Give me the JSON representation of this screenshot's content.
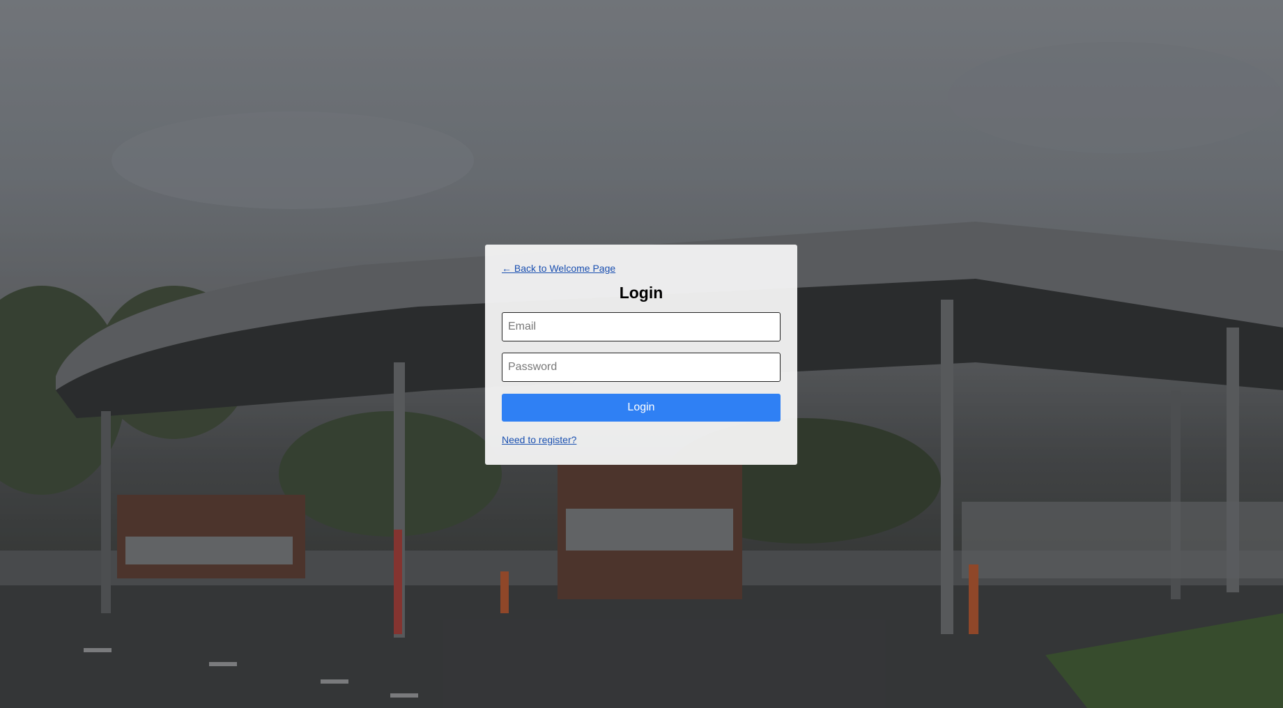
{
  "login_card": {
    "back_link": "← Back to Welcome Page",
    "title": "Login",
    "email_placeholder": "Email",
    "password_placeholder": "Password",
    "submit_label": "Login",
    "register_link": "Need to register?"
  },
  "background": {
    "description_icon": "border-checkpoint-photo",
    "accent_color": "#2f80f4",
    "link_color": "#1a4fb0"
  }
}
